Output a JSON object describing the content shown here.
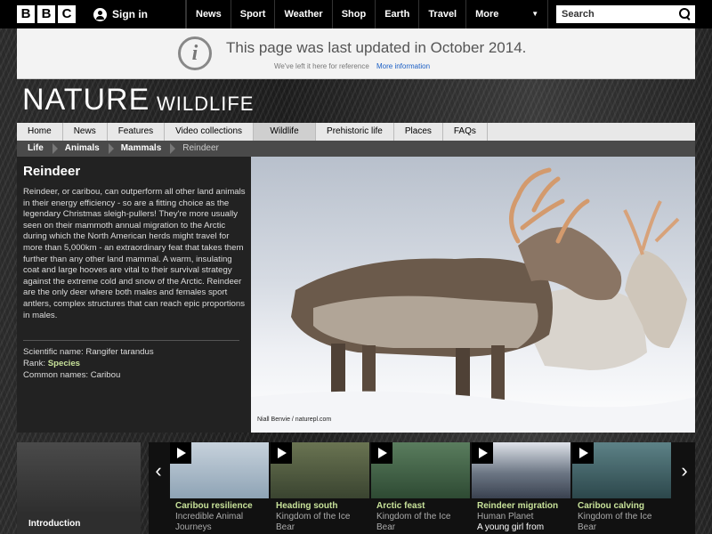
{
  "header": {
    "logo_letters": [
      "B",
      "B",
      "C"
    ],
    "signin_label": "Sign in",
    "nav": [
      "News",
      "Sport",
      "Weather",
      "Shop",
      "Earth",
      "Travel"
    ],
    "more_label": "More",
    "more_icon": "caret-down-icon",
    "search_placeholder": "Search"
  },
  "notice": {
    "icon": "info-icon",
    "title": "This page was last updated in October 2014.",
    "subtitle": "We've left it here for reference",
    "link": "More information"
  },
  "site": {
    "title": "NATURE",
    "subtitle": "WILDLIFE"
  },
  "subnav": {
    "items": [
      "Home",
      "News",
      "Features",
      "Video collections",
      "Wildlife",
      "Prehistoric life",
      "Places",
      "FAQs"
    ],
    "active": "Wildlife"
  },
  "breadcrumbs": [
    "Life",
    "Animals",
    "Mammals",
    "Reindeer"
  ],
  "animal": {
    "name": "Reindeer",
    "description": "Reindeer, or caribou, can outperform all other land animals in their energy efficiency - so are a fitting choice as the legendary Christmas sleigh-pullers! They're more usually seen on their mammoth annual migration to the Arctic during which the North American herds might travel for more than 5,000km - an extraordinary feat that takes them further than any other land mammal. A warm, insulating coat and large hooves are vital to their survival strategy against the extreme cold and snow of the Arctic. Reindeer are the only deer where both males and females sport antlers, complex structures that can reach epic proportions in males.",
    "scientific_label": "Scientific name:",
    "scientific_value": "Rangifer tarandus",
    "rank_label": "Rank:",
    "rank_value": "Species",
    "common_label": "Common names:",
    "common_value": "Caribou"
  },
  "hero": {
    "credit": "Niall Benvie / naturepl.com"
  },
  "carousel": {
    "intro_label": "Introduction",
    "clips": [
      {
        "title": "Caribou resilience",
        "subtitle": "Incredible Animal Journeys",
        "thumb": "#9fb3c4"
      },
      {
        "title": "Heading south",
        "subtitle": "Kingdom of the Ice Bear",
        "thumb": "#4c5a3e"
      },
      {
        "title": "Arctic feast",
        "subtitle": "Kingdom of the Ice Bear",
        "thumb": "#3f5e45"
      },
      {
        "title": "Reindeer migration",
        "subtitle": "Human Planet",
        "subtitle2": "A young girl from",
        "thumb": "#5a6878"
      },
      {
        "title": "Caribou calving",
        "subtitle": "Kingdom of the Ice Bear",
        "thumb": "#3d5f63"
      }
    ]
  }
}
